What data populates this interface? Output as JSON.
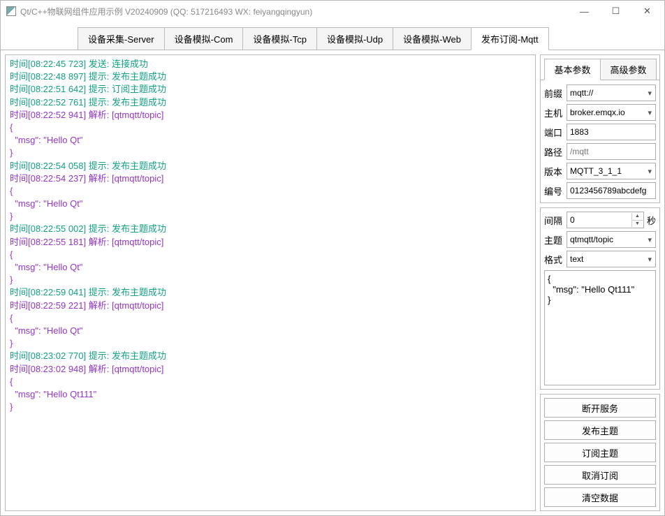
{
  "window": {
    "title": "Qt/C++物联网组件应用示例 V20240909 (QQ: 517216493 WX: feiyangqingyun)"
  },
  "main_tabs": [
    {
      "label": "设备采集-Server",
      "active": false
    },
    {
      "label": "设备模拟-Com",
      "active": false
    },
    {
      "label": "设备模拟-Tcp",
      "active": false
    },
    {
      "label": "设备模拟-Udp",
      "active": false
    },
    {
      "label": "设备模拟-Web",
      "active": false
    },
    {
      "label": "发布订阅-Mqtt",
      "active": true
    }
  ],
  "log": [
    {
      "cls": "c-teal",
      "text": "时间[08:22:45 723] 发送: 连接成功"
    },
    {
      "cls": "c-teal",
      "text": "时间[08:22:48 897] 提示: 发布主题成功"
    },
    {
      "cls": "c-teal",
      "text": "时间[08:22:51 642] 提示: 订阅主题成功"
    },
    {
      "cls": "c-teal",
      "text": "时间[08:22:52 761] 提示: 发布主题成功"
    },
    {
      "cls": "c-purple",
      "text": "时间[08:22:52 941] 解析: [qtmqtt/topic]"
    },
    {
      "cls": "c-purple",
      "text": "{"
    },
    {
      "cls": "c-purple",
      "text": "  \"msg\": \"Hello Qt\""
    },
    {
      "cls": "c-purple",
      "text": "}"
    },
    {
      "cls": "c-teal",
      "text": "时间[08:22:54 058] 提示: 发布主题成功"
    },
    {
      "cls": "c-purple",
      "text": "时间[08:22:54 237] 解析: [qtmqtt/topic]"
    },
    {
      "cls": "c-purple",
      "text": "{"
    },
    {
      "cls": "c-purple",
      "text": "  \"msg\": \"Hello Qt\""
    },
    {
      "cls": "c-purple",
      "text": "}"
    },
    {
      "cls": "c-teal",
      "text": "时间[08:22:55 002] 提示: 发布主题成功"
    },
    {
      "cls": "c-purple",
      "text": "时间[08:22:55 181] 解析: [qtmqtt/topic]"
    },
    {
      "cls": "c-purple",
      "text": "{"
    },
    {
      "cls": "c-purple",
      "text": "  \"msg\": \"Hello Qt\""
    },
    {
      "cls": "c-purple",
      "text": "}"
    },
    {
      "cls": "c-teal",
      "text": "时间[08:22:59 041] 提示: 发布主题成功"
    },
    {
      "cls": "c-purple",
      "text": "时间[08:22:59 221] 解析: [qtmqtt/topic]"
    },
    {
      "cls": "c-purple",
      "text": "{"
    },
    {
      "cls": "c-purple",
      "text": "  \"msg\": \"Hello Qt\""
    },
    {
      "cls": "c-purple",
      "text": "}"
    },
    {
      "cls": "c-teal",
      "text": "时间[08:23:02 770] 提示: 发布主题成功"
    },
    {
      "cls": "c-purple",
      "text": "时间[08:23:02 948] 解析: [qtmqtt/topic]"
    },
    {
      "cls": "c-purple",
      "text": "{"
    },
    {
      "cls": "c-purple",
      "text": "  \"msg\": \"Hello Qt111\""
    },
    {
      "cls": "c-purple",
      "text": "}"
    }
  ],
  "side": {
    "sub_tabs": [
      {
        "label": "基本参数",
        "active": true
      },
      {
        "label": "高级参数",
        "active": false
      }
    ],
    "basic": {
      "prefix_label": "前缀",
      "prefix": "mqtt://",
      "host_label": "主机",
      "host": "broker.emqx.io",
      "port_label": "端口",
      "port": "1883",
      "path_label": "路径",
      "path_placeholder": "/mqtt",
      "version_label": "版本",
      "version": "MQTT_3_1_1",
      "id_label": "编号",
      "id": "0123456789abcdefg"
    },
    "pub": {
      "interval_label": "间隔",
      "interval": "0",
      "interval_unit": "秒",
      "topic_label": "主题",
      "topic": "qtmqtt/topic",
      "format_label": "格式",
      "format": "text",
      "payload": "{\n  \"msg\": \"Hello Qt111\"\n}"
    },
    "buttons": {
      "disconnect": "断开服务",
      "publish": "发布主题",
      "subscribe": "订阅主题",
      "unsubscribe": "取消订阅",
      "clear": "清空数据"
    }
  }
}
